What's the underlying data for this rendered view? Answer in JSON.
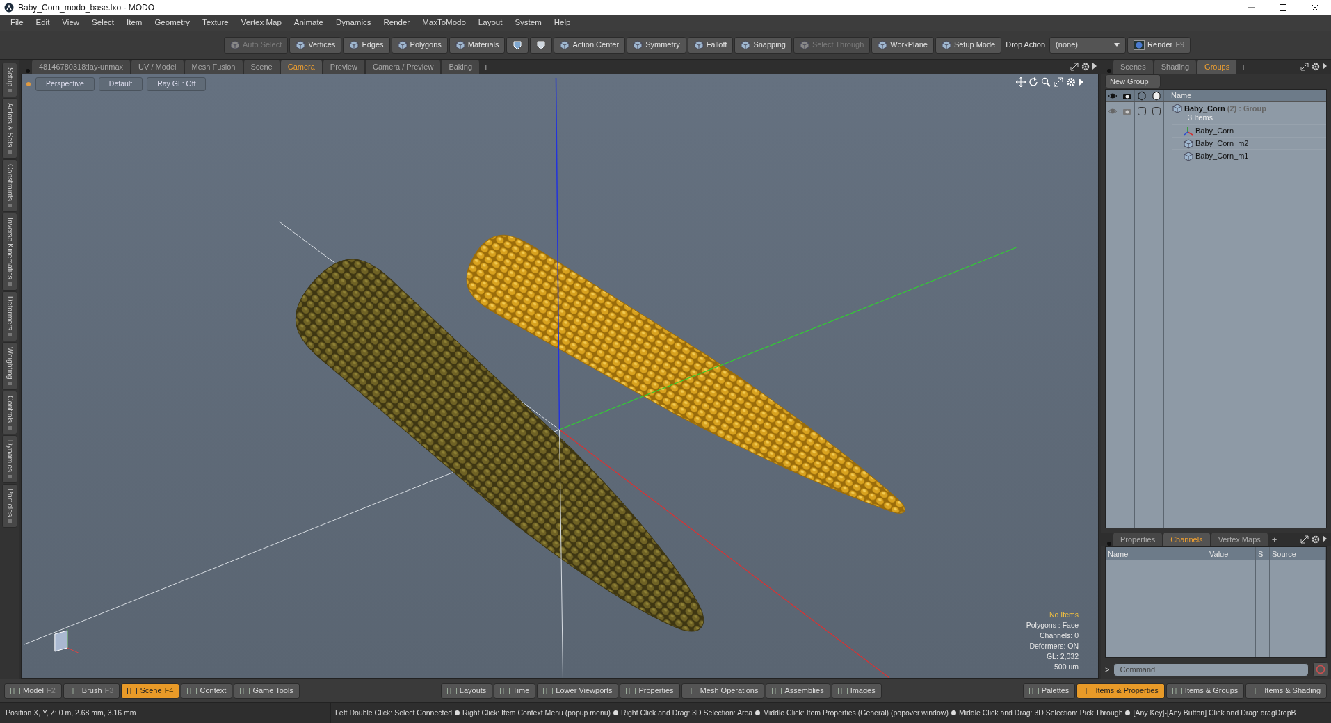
{
  "window": {
    "title": "Baby_Corn_modo_base.lxo - MODO"
  },
  "menu": [
    "File",
    "Edit",
    "View",
    "Select",
    "Item",
    "Geometry",
    "Texture",
    "Vertex Map",
    "Animate",
    "Dynamics",
    "Render",
    "MaxToModo",
    "Layout",
    "System",
    "Help"
  ],
  "toolbar": [
    {
      "kind": "tool",
      "label": "Auto Select",
      "disabled": true
    },
    {
      "kind": "tool",
      "label": "Vertices",
      "disabled": false
    },
    {
      "kind": "tool",
      "label": "Edges",
      "disabled": false
    },
    {
      "kind": "tool",
      "label": "Polygons",
      "disabled": false
    },
    {
      "kind": "tool",
      "label": "Materials",
      "disabled": false
    },
    {
      "kind": "icons"
    },
    {
      "kind": "tool",
      "label": "Action Center",
      "disabled": false
    },
    {
      "kind": "tool",
      "label": "Symmetry",
      "disabled": false
    },
    {
      "kind": "tool",
      "label": "Falloff",
      "disabled": false
    },
    {
      "kind": "tool",
      "label": "Snapping",
      "disabled": false
    },
    {
      "kind": "tool",
      "label": "Select Through",
      "disabled": true
    },
    {
      "kind": "tool",
      "label": "WorkPlane",
      "disabled": false
    },
    {
      "kind": "tool",
      "label": "Setup Mode",
      "disabled": false
    },
    {
      "kind": "label",
      "label": "Drop Action"
    },
    {
      "kind": "dropdown",
      "label": "(none)"
    },
    {
      "kind": "render",
      "label": "Render",
      "shortcut": "F9"
    }
  ],
  "viewport_add_tab": "+",
  "left_tabs": [
    "Setup",
    "Actors & Sets",
    "Constraints",
    "Inverse Kinematics",
    "Deformers",
    "Weighting",
    "Controls",
    "Dynamics",
    "Particles"
  ],
  "viewport_tabs": [
    {
      "label": "48146780318:lay-unmax",
      "selected": false
    },
    {
      "label": "UV / Model",
      "selected": false
    },
    {
      "label": "Mesh Fusion",
      "selected": false
    },
    {
      "label": "Scene",
      "selected": false
    },
    {
      "label": "Camera",
      "selected": true
    },
    {
      "label": "Preview",
      "selected": false
    },
    {
      "label": "Camera / Preview",
      "selected": false
    },
    {
      "label": "Baking",
      "selected": false
    }
  ],
  "viewport": {
    "header": [
      "Perspective",
      "Default",
      "Ray GL: Off"
    ],
    "info": [
      {
        "text": "No Items",
        "kind": "highlight"
      },
      {
        "text": "Polygons : Face",
        "kind": "plain"
      },
      {
        "text": "Channels: 0",
        "kind": "plain"
      },
      {
        "text": "Deformers: ON",
        "kind": "plain"
      },
      {
        "text": "GL: 2,032",
        "kind": "plain"
      },
      {
        "text": "500 um",
        "kind": "plain"
      }
    ]
  },
  "groups_panel": {
    "tabs": [
      {
        "label": "Scenes",
        "selected": false
      },
      {
        "label": "Shading",
        "selected": false
      },
      {
        "label": "Groups",
        "selected": true
      }
    ],
    "add_tab": "+",
    "new_group": "New Group",
    "name_column": "Name",
    "tree": [
      {
        "name": "Baby_Corn",
        "count": "(2)",
        "type": ": Group",
        "subtitle": "3 Items",
        "kind": "group",
        "children": [
          {
            "name": "Baby_Corn",
            "kind": "locator"
          },
          {
            "name": "Baby_Corn_m2",
            "kind": "mesh"
          },
          {
            "name": "Baby_Corn_m1",
            "kind": "mesh"
          }
        ]
      }
    ]
  },
  "channels_panel": {
    "tabs": [
      {
        "label": "Properties",
        "selected": false
      },
      {
        "label": "Channels",
        "selected": true
      },
      {
        "label": "Vertex Maps",
        "selected": false
      }
    ],
    "add_tab": "+",
    "columns": [
      "Name",
      "Value",
      "S",
      "Source"
    ]
  },
  "command": {
    "prompt": ">",
    "placeholder": "Command"
  },
  "bottom_toolbar": {
    "left": [
      {
        "label": "Model",
        "shortcut": "F2",
        "selected": false
      },
      {
        "label": "Brush",
        "shortcut": "F3",
        "selected": false
      },
      {
        "label": "Scene",
        "shortcut": "F4",
        "selected": true
      },
      {
        "label": "Context",
        "selected": false
      },
      {
        "label": "Game Tools",
        "selected": false
      }
    ],
    "center": [
      {
        "label": "Layouts",
        "selected": false
      },
      {
        "label": "Time",
        "selected": false
      },
      {
        "label": "Lower Viewports",
        "selected": false
      },
      {
        "label": "Properties",
        "selected": false
      },
      {
        "label": "Mesh Operations",
        "selected": false
      },
      {
        "label": "Assemblies",
        "selected": false
      },
      {
        "label": "Images",
        "selected": false
      }
    ],
    "right": [
      {
        "label": "Palettes",
        "selected": false
      },
      {
        "label": "Items & Properties",
        "selected": true
      },
      {
        "label": "Items & Groups",
        "selected": false
      },
      {
        "label": "Items & Shading",
        "selected": false
      }
    ]
  },
  "status_bar": {
    "position": "Position X, Y, Z:  0 m, 2.68 mm, 3.16 mm",
    "hints": [
      "Left Double Click: Select Connected",
      "Right Click: Item Context Menu (popup menu)",
      "Right Click and Drag: 3D Selection: Area",
      "Middle Click: Item Properties (General) (popover window)",
      "Middle Click and Drag: 3D Selection: Pick Through",
      "[Any Key]-[Any Button] Click and Drag: dragDropB"
    ]
  }
}
